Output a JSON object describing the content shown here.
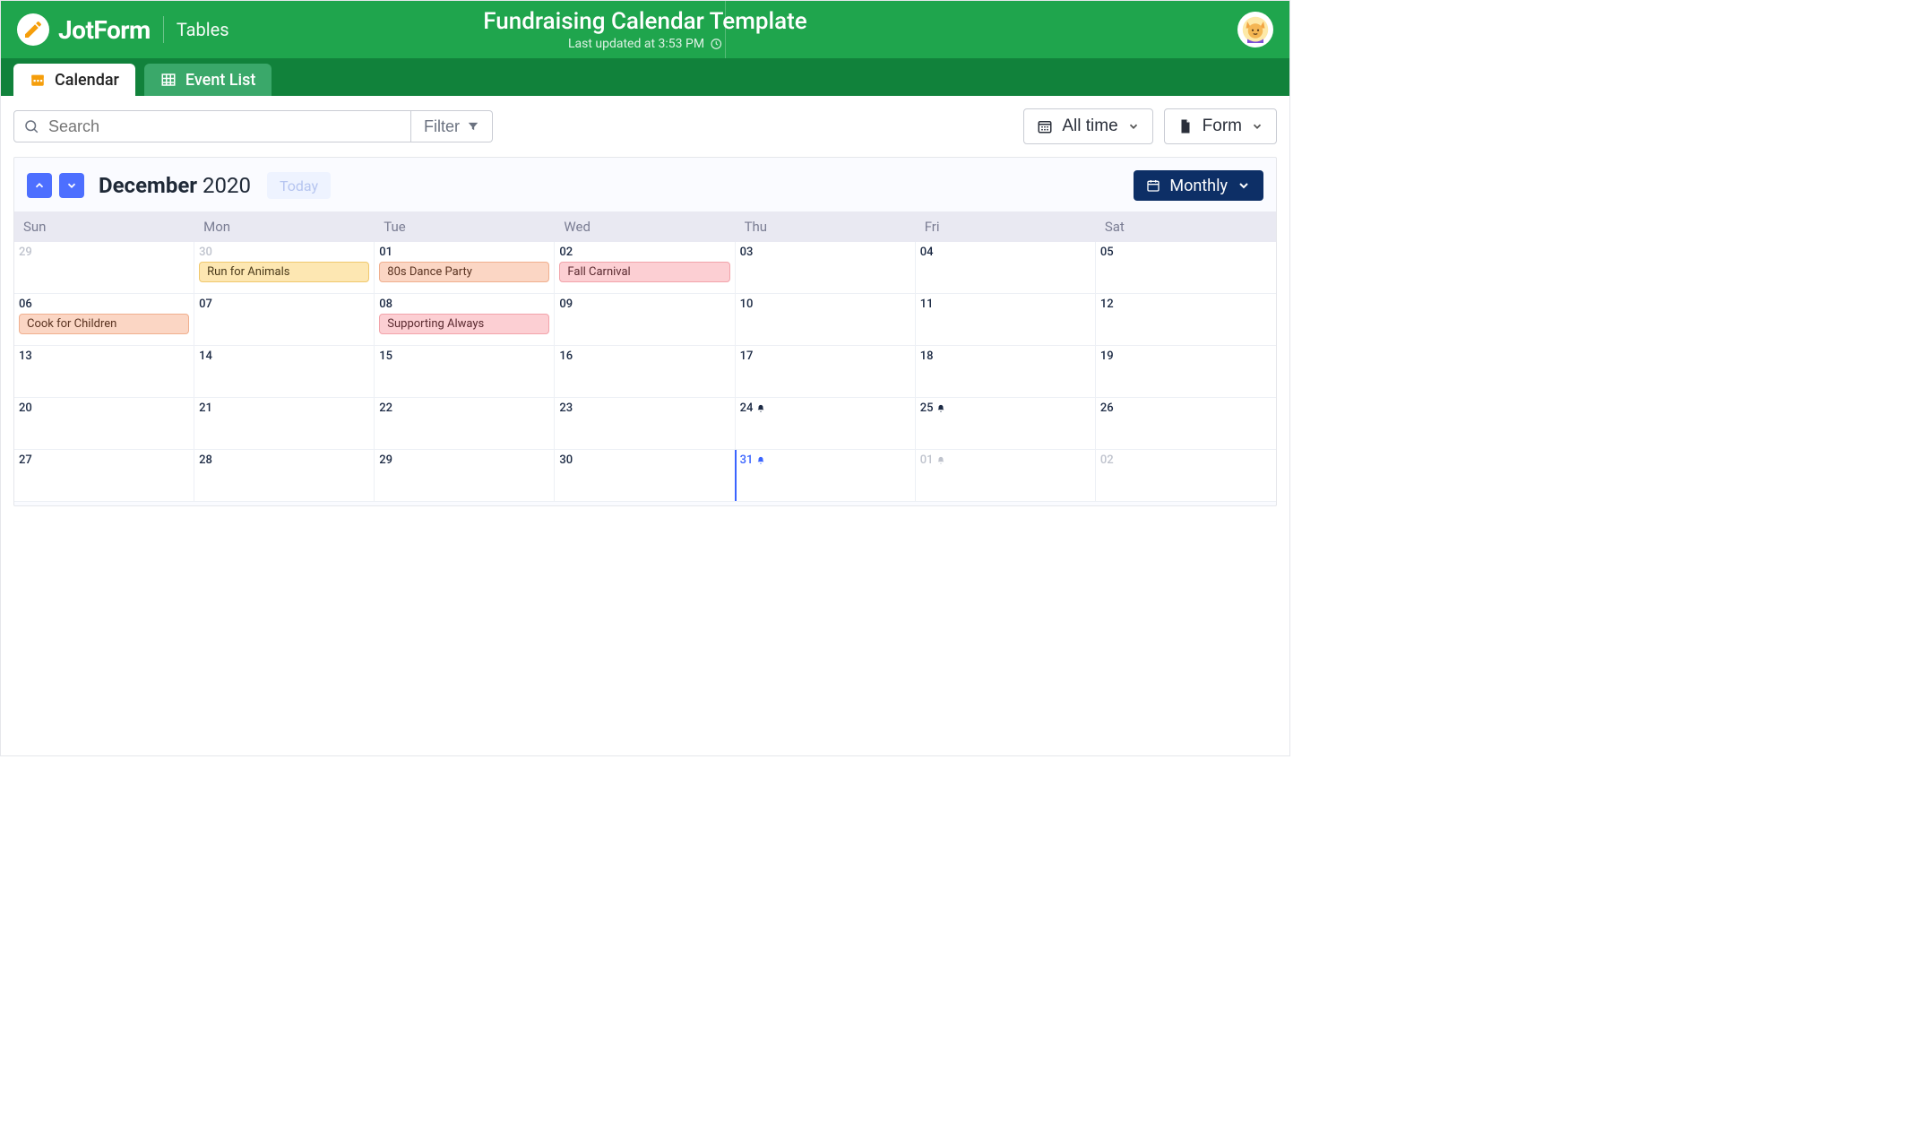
{
  "header": {
    "brand": "JotForm",
    "section": "Tables",
    "title": "Fundraising Calendar Template",
    "subtitle": "Last updated at 3:53 PM"
  },
  "tabs": [
    {
      "label": "Calendar",
      "active": true
    },
    {
      "label": "Event List",
      "active": false
    }
  ],
  "toolbar": {
    "search_placeholder": "Search",
    "filter_label": "Filter",
    "timerange_label": "All time",
    "form_label": "Form"
  },
  "calendar": {
    "month": "December",
    "year": "2020",
    "today_label": "Today",
    "view_label": "Monthly",
    "weekdays": [
      "Sun",
      "Mon",
      "Tue",
      "Wed",
      "Thu",
      "Fri",
      "Sat"
    ],
    "cells": [
      {
        "d": "29",
        "out": true
      },
      {
        "d": "30",
        "out": true,
        "event": {
          "label": "Run for Animals",
          "cls": "ev-yellow"
        }
      },
      {
        "d": "01",
        "event": {
          "label": "80s Dance Party",
          "cls": "ev-orange"
        }
      },
      {
        "d": "02",
        "event": {
          "label": "Fall Carnival",
          "cls": "ev-pink"
        }
      },
      {
        "d": "03"
      },
      {
        "d": "04"
      },
      {
        "d": "05"
      },
      {
        "d": "06",
        "event": {
          "label": "Cook for Children",
          "cls": "ev-peach"
        }
      },
      {
        "d": "07"
      },
      {
        "d": "08",
        "event": {
          "label": "Supporting Always",
          "cls": "ev-rose"
        }
      },
      {
        "d": "09"
      },
      {
        "d": "10"
      },
      {
        "d": "11"
      },
      {
        "d": "12"
      },
      {
        "d": "13"
      },
      {
        "d": "14"
      },
      {
        "d": "15"
      },
      {
        "d": "16"
      },
      {
        "d": "17"
      },
      {
        "d": "18"
      },
      {
        "d": "19"
      },
      {
        "d": "20"
      },
      {
        "d": "21"
      },
      {
        "d": "22"
      },
      {
        "d": "23"
      },
      {
        "d": "24",
        "bell": true
      },
      {
        "d": "25",
        "bell": true
      },
      {
        "d": "26"
      },
      {
        "d": "27"
      },
      {
        "d": "28"
      },
      {
        "d": "29"
      },
      {
        "d": "30"
      },
      {
        "d": "31",
        "today": true,
        "bell": true
      },
      {
        "d": "01",
        "out": true,
        "bell": true
      },
      {
        "d": "02",
        "out": true
      }
    ]
  }
}
